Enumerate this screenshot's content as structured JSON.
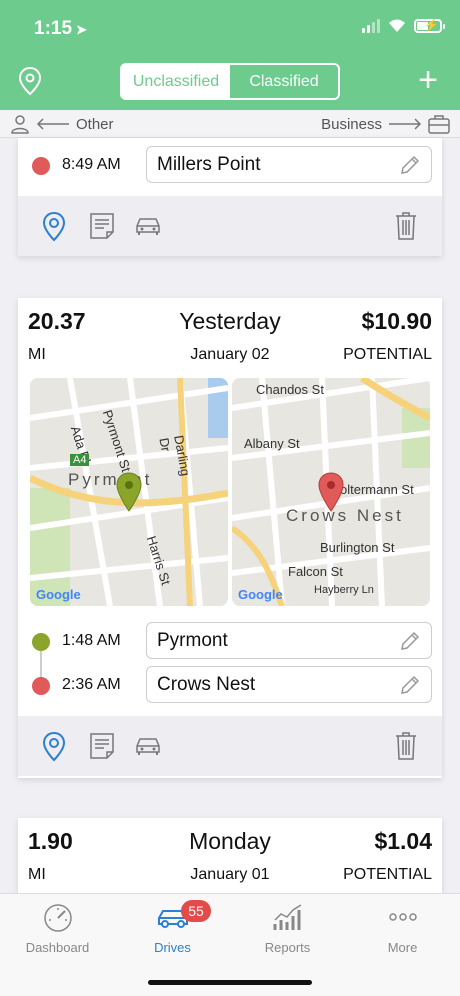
{
  "status": {
    "time": "1:15"
  },
  "header": {
    "segments": [
      {
        "label": "Unclassified",
        "active": true
      },
      {
        "label": "Classified",
        "active": false
      }
    ],
    "accent": "#6ccb8d"
  },
  "hint": {
    "left": "Other",
    "right": "Business"
  },
  "card_prev": {
    "stop": {
      "time": "8:49 AM",
      "place": "Millers Point",
      "color": "#e05a5a"
    }
  },
  "card_main": {
    "distance": "20.37",
    "unit": "MI",
    "day": "Yesterday",
    "date": "January 02",
    "amount": "$10.90",
    "potential": "POTENTIAL",
    "map_start": {
      "streets": [
        "Pyrmont St",
        "Ada Pl",
        "Darling Dr",
        "Harris St",
        "A4"
      ],
      "area": "Pyrmont",
      "credit": "Google"
    },
    "map_end": {
      "streets": [
        "Chandos St",
        "Albany St",
        "oltermann St",
        "Burlington St",
        "Falcon St",
        "Hayberry Ln"
      ],
      "area": "Crows Nest",
      "credit": "Google"
    },
    "stops": [
      {
        "time": "1:48 AM",
        "place": "Pyrmont",
        "color": "#8aa52a"
      },
      {
        "time": "2:36 AM",
        "place": "Crows Nest",
        "color": "#e05a5a"
      }
    ]
  },
  "card_next": {
    "distance": "1.90",
    "unit": "MI",
    "day": "Monday",
    "date": "January 01",
    "amount": "$1.04",
    "potential": "POTENTIAL"
  },
  "tabs": [
    {
      "label": "Dashboard",
      "icon": "dashboard-icon",
      "active": false
    },
    {
      "label": "Drives",
      "icon": "car-icon",
      "active": true,
      "badge": "55"
    },
    {
      "label": "Reports",
      "icon": "reports-icon",
      "active": false
    },
    {
      "label": "More",
      "icon": "more-icon",
      "active": false
    }
  ]
}
